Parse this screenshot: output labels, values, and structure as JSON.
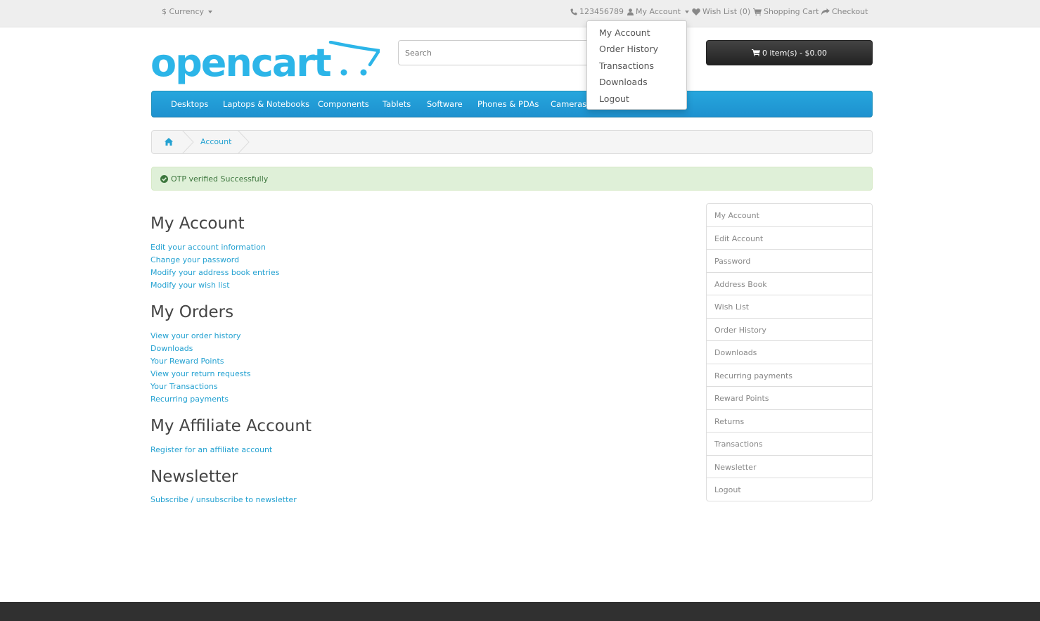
{
  "top": {
    "currency": "$ Currency",
    "phone": "123456789",
    "my_account": "My Account",
    "wishlist": "Wish List (0)",
    "shopping_cart": "Shopping Cart",
    "checkout": "Checkout"
  },
  "account_dropdown": [
    "My Account",
    "Order History",
    "Transactions",
    "Downloads",
    "Logout"
  ],
  "header": {
    "logo": "opencart",
    "search_placeholder": "Search",
    "cart": "0 item(s) - $0.00"
  },
  "menu": [
    "Desktops",
    "Laptops & Notebooks",
    "Components",
    "Tablets",
    "Software",
    "Phones & PDAs",
    "Cameras"
  ],
  "breadcrumb": {
    "home_icon": "home-icon",
    "account": "Account"
  },
  "alert": "OTP verified Successfully",
  "sections": [
    {
      "title": "My Account",
      "links": [
        "Edit your account information",
        "Change your password",
        "Modify your address book entries",
        "Modify your wish list"
      ]
    },
    {
      "title": "My Orders",
      "links": [
        "View your order history",
        "Downloads",
        "Your Reward Points",
        "View your return requests",
        "Your Transactions",
        "Recurring payments"
      ]
    },
    {
      "title": "My Affiliate Account",
      "links": [
        "Register for an affiliate account"
      ]
    },
    {
      "title": "Newsletter",
      "links": [
        "Subscribe / unsubscribe to newsletter"
      ]
    }
  ],
  "sidebar": [
    "My Account",
    "Edit Account",
    "Password",
    "Address Book",
    "Wish List",
    "Order History",
    "Downloads",
    "Recurring payments",
    "Reward Points",
    "Returns",
    "Transactions",
    "Newsletter",
    "Logout"
  ],
  "colors": {
    "accent": "#23a1d1",
    "menu": "#229ac8",
    "alert_bg": "#dff0d8",
    "footer": "#303030"
  }
}
